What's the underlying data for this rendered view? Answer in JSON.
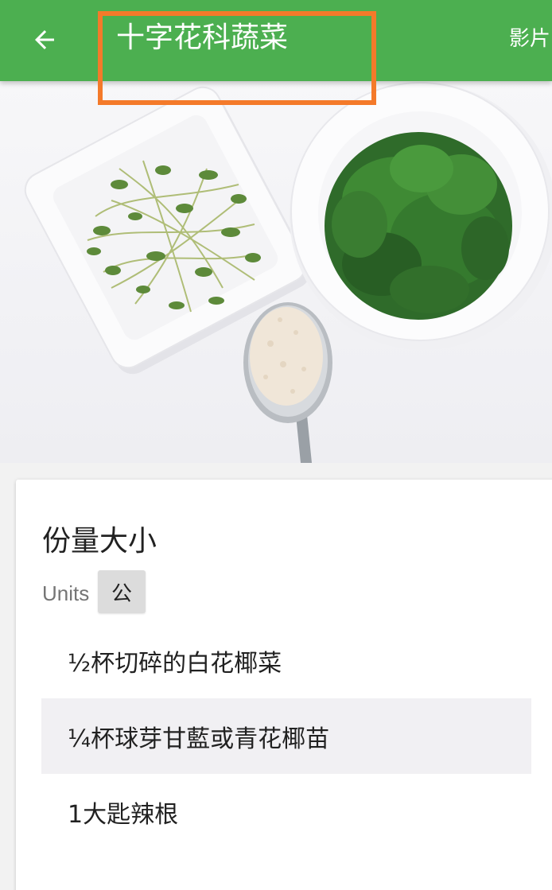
{
  "appbar": {
    "title": "十字花科蔬菜",
    "action_label": "影片",
    "back_icon": "arrow-left-icon",
    "color": "#4caf50",
    "annotation_color": "#f47a2a"
  },
  "hero": {
    "icon": "vegetables-photo"
  },
  "serving": {
    "heading": "份量大小",
    "units_label": "Units",
    "units_value": "公"
  },
  "ingredients": [
    {
      "text": "½杯切碎的白花椰菜"
    },
    {
      "text": "¼杯球芽甘藍或青花椰苗"
    },
    {
      "text": "1大匙辣根"
    }
  ]
}
